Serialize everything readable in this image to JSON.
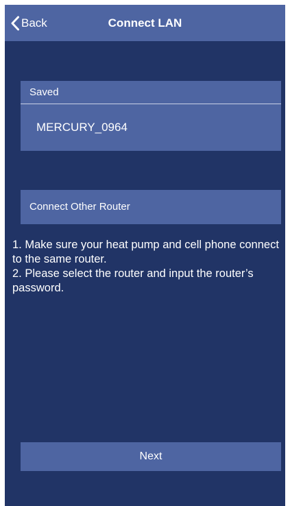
{
  "navbar": {
    "back_label": "Back",
    "back_icon": "chevron-left-icon",
    "title": "Connect LAN"
  },
  "saved": {
    "header": "Saved",
    "network_name": "MERCURY_0964"
  },
  "other_router": {
    "label": "Connect Other Router"
  },
  "instructions": {
    "line1": "1. Make sure your heat pump and cell phone connect to the same router.",
    "line2": "2. Please select the router and input the router’s password."
  },
  "footer": {
    "next_label": "Next"
  },
  "colors": {
    "background": "#213466",
    "panel": "#4e65a2",
    "text": "#ffffff"
  }
}
